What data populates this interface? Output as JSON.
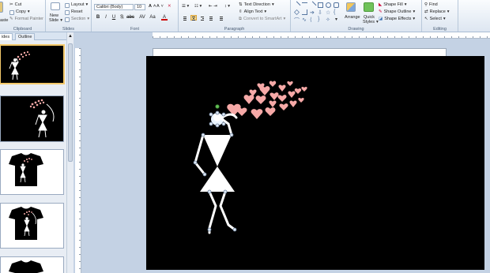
{
  "ribbon": {
    "clipboard": {
      "label": "Clipboard",
      "paste": "aste",
      "cut": "Cut",
      "copy": "Copy",
      "format_painter": "Format Painter"
    },
    "slides": {
      "label": "Slides",
      "new_slide_line1": "New",
      "new_slide_line2": "Slide",
      "layout": "Layout",
      "reset": "Reset",
      "section": "Section"
    },
    "font": {
      "label": "Font",
      "font_name": "Calibri (Body)",
      "font_size": "10",
      "bold": "B",
      "italic": "I",
      "underline": "U",
      "strike": "S",
      "shadow": "abc",
      "spacing": "AV",
      "case": "Aa",
      "color": "A",
      "grow": "A",
      "shrink": "A"
    },
    "paragraph": {
      "label": "Paragraph",
      "text_direction": "Text Direction",
      "align_text": "Align Text",
      "convert_smartart": "Convert to SmartArt"
    },
    "drawing": {
      "label": "Drawing",
      "arrange": "Arrange",
      "quick_styles_line1": "Quick",
      "quick_styles_line2": "Styles",
      "shape_fill": "Shape Fill",
      "shape_outline": "Shape Outline",
      "shape_effects": "Shape Effects"
    },
    "editing": {
      "label": "Editing",
      "find": "Find",
      "replace": "Replace",
      "select": "Select"
    }
  },
  "panel": {
    "tab_slides": "ides",
    "tab_outline": "Outline"
  },
  "thumbnails": [
    {
      "number": "",
      "kind": "dancer-small"
    },
    {
      "number": "",
      "kind": "dancer-large"
    },
    {
      "number": "",
      "kind": "tshirt-black-on-white"
    },
    {
      "number": "",
      "kind": "tshirt-black-on-white"
    },
    {
      "number": "",
      "kind": "tshirt-partial"
    }
  ],
  "colors": {
    "heart": "#f6a9a7",
    "figure": "#ffffff",
    "slide_bg": "#000000",
    "selection": "#f4c96a",
    "handle_green": "#66c35a"
  }
}
